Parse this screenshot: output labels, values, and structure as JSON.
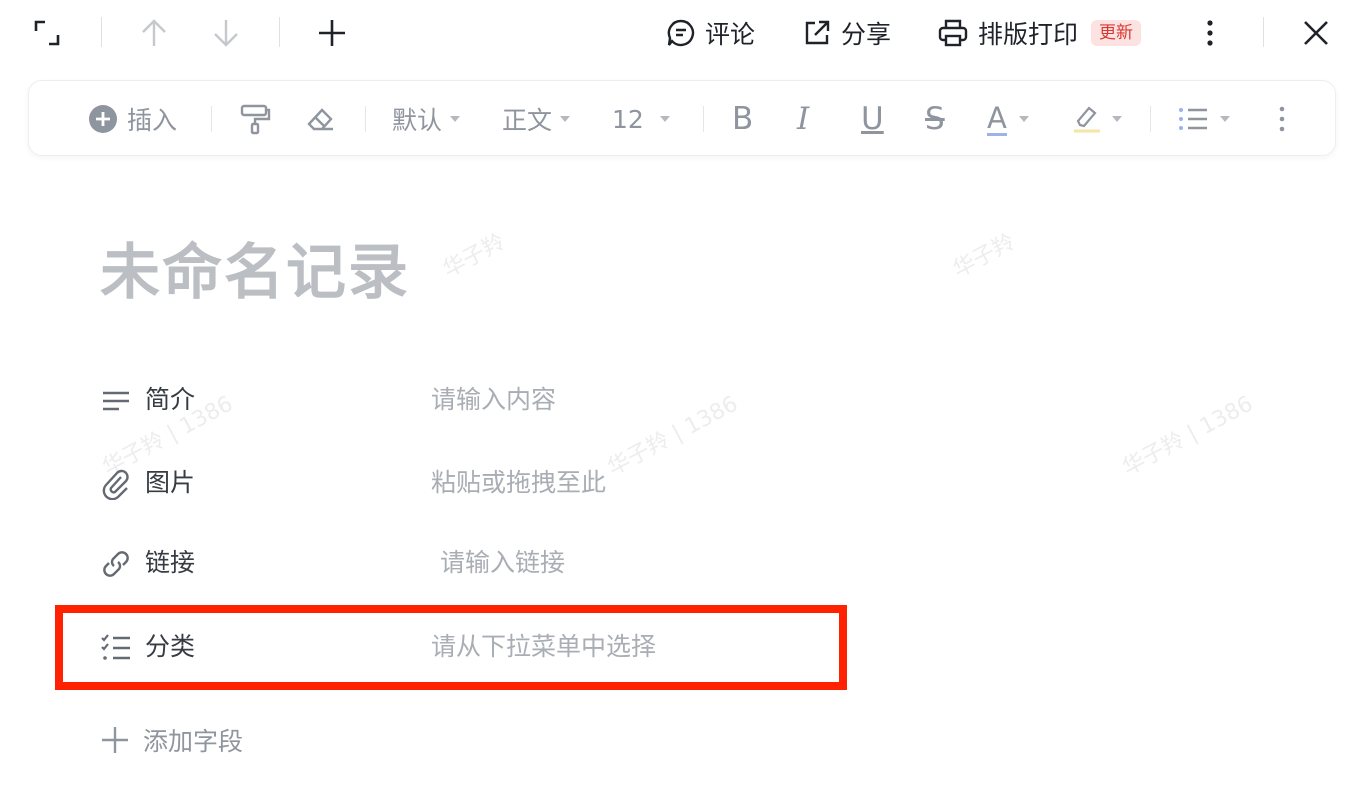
{
  "topbar": {
    "comment_label": "评论",
    "share_label": "分享",
    "print_label": "排版打印",
    "print_badge": "更新"
  },
  "toolbar": {
    "insert_label": "插入",
    "font_label": "默认",
    "style_label": "正文",
    "size_label": "12",
    "bold": "B",
    "italic": "I",
    "underline": "U",
    "strike": "S",
    "font_color": "A"
  },
  "doc": {
    "title": "未命名记录",
    "fields": [
      {
        "label": "简介",
        "placeholder": "请输入内容",
        "icon": "text-lines-icon"
      },
      {
        "label": "图片",
        "placeholder": "粘贴或拖拽至此",
        "icon": "paperclip-icon"
      },
      {
        "label": "链接",
        "placeholder": "请输入链接",
        "icon": "link-icon"
      },
      {
        "label": "分类",
        "placeholder": "请从下拉菜单中选择",
        "icon": "checklist-icon"
      }
    ],
    "add_field_label": "添加字段"
  },
  "watermarks": [
    "华子羚",
    "华子羚",
    "华子羚 | 1386",
    "华子羚 | 1386",
    "华子羚 | 1386"
  ],
  "colors": {
    "accent_highlight": "#ff2200",
    "badge_bg": "#fde2e2",
    "badge_text": "#d83931",
    "placeholder": "#a9adb4",
    "title": "#bbbfc4"
  }
}
